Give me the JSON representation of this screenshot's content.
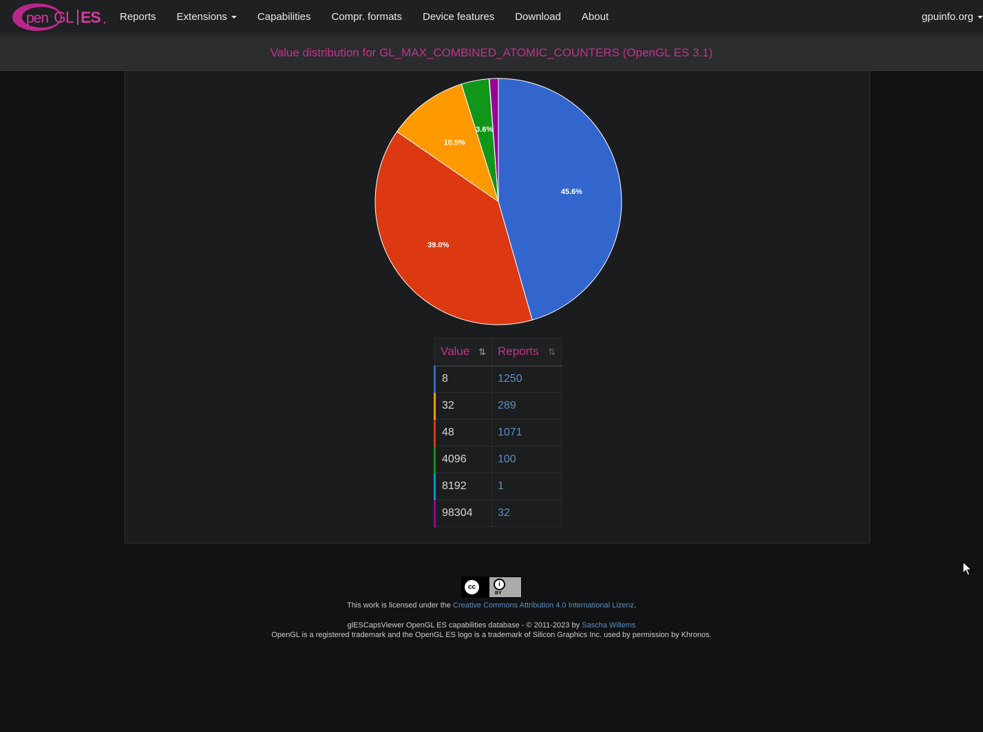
{
  "navbar": {
    "logo_text": "OpenGL ES",
    "items": [
      {
        "label": "Reports"
      },
      {
        "label": "Extensions",
        "dropdown": true
      },
      {
        "label": "Capabilities"
      },
      {
        "label": "Compr. formats"
      },
      {
        "label": "Device features"
      },
      {
        "label": "Download"
      },
      {
        "label": "About"
      }
    ],
    "right_label": "gpuinfo.org"
  },
  "page": {
    "title": "Value distribution for GL_MAX_COMBINED_ATOMIC_COUNTERS (OpenGL ES 3.1)"
  },
  "chart_data": {
    "type": "pie",
    "slices": [
      {
        "value": "8",
        "reports": 1250,
        "percent_label": "45.6%",
        "color": "#3366cc"
      },
      {
        "value": "48",
        "reports": 1071,
        "percent_label": "39.0%",
        "color": "#dc3912"
      },
      {
        "value": "32",
        "reports": 289,
        "percent_label": "10.5%",
        "color": "#ff9900"
      },
      {
        "value": "4096",
        "reports": 100,
        "percent_label": "3.6%",
        "color": "#109618"
      },
      {
        "value": "8192",
        "reports": 1,
        "percent_label": "",
        "color": "#0099c6"
      },
      {
        "value": "98304",
        "reports": 32,
        "percent_label": "",
        "color": "#990099"
      }
    ]
  },
  "table": {
    "headers": {
      "value": "Value",
      "reports": "Reports"
    },
    "rows": [
      {
        "value": "8",
        "reports": "1250",
        "color": "#3366cc"
      },
      {
        "value": "32",
        "reports": "289",
        "color": "#ff9900"
      },
      {
        "value": "48",
        "reports": "1071",
        "color": "#dc3912"
      },
      {
        "value": "4096",
        "reports": "100",
        "color": "#109618"
      },
      {
        "value": "8192",
        "reports": "1",
        "color": "#0099c6"
      },
      {
        "value": "98304",
        "reports": "32",
        "color": "#990099"
      }
    ]
  },
  "footer": {
    "cc_badge_label": "cc",
    "by_label": "BY",
    "license_prefix": "This work is licensed under the ",
    "license_link": "Creative Commons Attribution 4.0 International Lizenz",
    "license_suffix": ".",
    "copyright_prefix": "glESCapsViewer OpenGL ES capabilities database - © 2011-2023 by ",
    "author_link": "Sascha Willems",
    "trademark": "OpenGL is a registered trademark and the OpenGL ES logo is a trademark of Silicon Graphics Inc. used by permission by Khronos."
  }
}
